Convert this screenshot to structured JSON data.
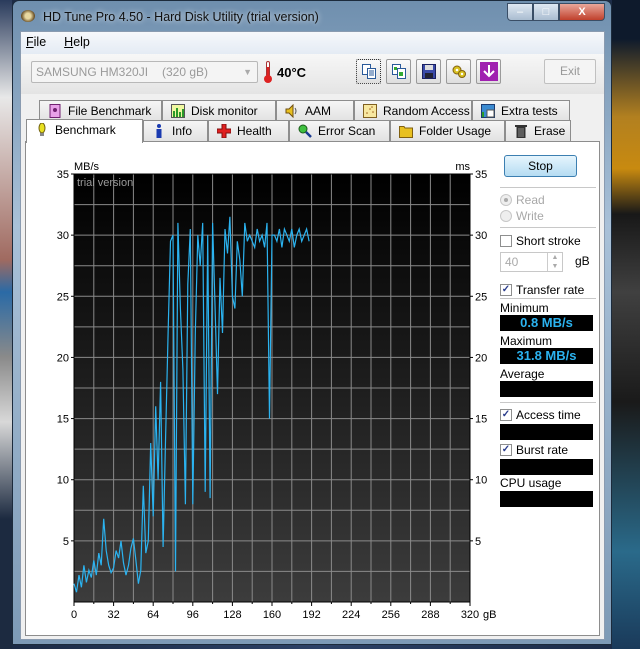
{
  "window": {
    "title": "HD Tune Pro 4.50 - Hard Disk Utility (trial version)",
    "controls": {
      "minimize": "–",
      "maximize": "□",
      "close": "X"
    }
  },
  "menu": {
    "items": [
      {
        "label": "File",
        "accel": "F"
      },
      {
        "label": "Help",
        "accel": "H"
      }
    ]
  },
  "toolbar": {
    "drive_name": "SAMSUNG HM320JI",
    "drive_size": "(320 gB)",
    "temperature": "40°C",
    "buttons": [
      {
        "name": "copy-text-icon"
      },
      {
        "name": "copy-screenshot-icon"
      },
      {
        "name": "save-icon"
      },
      {
        "name": "options-icon"
      },
      {
        "name": "download-icon"
      }
    ],
    "exit_label": "Exit"
  },
  "tabs": {
    "row1": [
      {
        "label": "File Benchmark",
        "icon": "file-benchmark-icon"
      },
      {
        "label": "Disk monitor",
        "icon": "disk-monitor-icon"
      },
      {
        "label": "AAM",
        "icon": "speaker-icon"
      },
      {
        "label": "Random Access",
        "icon": "random-access-icon"
      },
      {
        "label": "Extra tests",
        "icon": "extra-tests-icon"
      }
    ],
    "row2": [
      {
        "label": "Benchmark",
        "icon": "benchmark-icon",
        "active": true
      },
      {
        "label": "Info",
        "icon": "info-icon"
      },
      {
        "label": "Health",
        "icon": "health-icon"
      },
      {
        "label": "Error Scan",
        "icon": "error-scan-icon"
      },
      {
        "label": "Folder Usage",
        "icon": "folder-icon"
      },
      {
        "label": "Erase",
        "icon": "trash-icon"
      }
    ]
  },
  "side": {
    "stop_label": "Stop",
    "read_label": "Read",
    "write_label": "Write",
    "short_stroke_label": "Short stroke",
    "short_stroke_checked": false,
    "short_stroke_value": "40",
    "short_stroke_unit": "gB",
    "transfer_rate_label": "Transfer rate",
    "transfer_rate_checked": true,
    "minimum_label": "Minimum",
    "minimum_value": "0.8 MB/s",
    "maximum_label": "Maximum",
    "maximum_value": "31.8 MB/s",
    "average_label": "Average",
    "average_value": "",
    "access_time_label": "Access time",
    "access_time_checked": true,
    "access_time_value": "",
    "burst_rate_label": "Burst rate",
    "burst_rate_checked": true,
    "burst_rate_value": "",
    "cpu_usage_label": "CPU usage",
    "cpu_usage_value": ""
  },
  "chart_data": {
    "type": "line",
    "title": "",
    "watermark": "trial version",
    "ylabel": "MB/s",
    "ylabel_right": "ms",
    "xlabel": "gB",
    "ylim": [
      0,
      35
    ],
    "xlim": [
      0,
      320
    ],
    "yticks": [
      5,
      10,
      15,
      20,
      25,
      30,
      35
    ],
    "xticks": [
      0,
      32,
      64,
      96,
      128,
      160,
      192,
      224,
      256,
      288,
      320
    ],
    "grid": true,
    "line_color": "#2bb3f0",
    "series": [
      {
        "name": "Transfer rate",
        "x": [
          0,
          2,
          4,
          6,
          8,
          10,
          12,
          14,
          16,
          18,
          20,
          22,
          24,
          26,
          28,
          30,
          32,
          34,
          36,
          38,
          40,
          42,
          44,
          46,
          48,
          50,
          52,
          54,
          56,
          58,
          60,
          62,
          64,
          66,
          68,
          70,
          72,
          74,
          76,
          78,
          80,
          82,
          84,
          86,
          88,
          90,
          92,
          94,
          96,
          98,
          100,
          102,
          104,
          106,
          108,
          110,
          112,
          114,
          116,
          118,
          120,
          122,
          124,
          126,
          128,
          130,
          132,
          134,
          136,
          138,
          140,
          142,
          144,
          146,
          148,
          150,
          152,
          154,
          156,
          158,
          160,
          162,
          164,
          166,
          168,
          170,
          172,
          174,
          176,
          178,
          180,
          182,
          184,
          186,
          188,
          190
        ],
        "values": [
          1.5,
          0.8,
          2.2,
          1.2,
          3.0,
          1.6,
          2.6,
          2.0,
          3.4,
          2.2,
          4.0,
          3.0,
          6.8,
          4.2,
          3.0,
          2.4,
          2.8,
          4.2,
          3.6,
          5.0,
          3.2,
          2.2,
          3.0,
          4.4,
          5.2,
          3.4,
          1.5,
          2.6,
          9.5,
          4.0,
          5.0,
          13.0,
          7.0,
          16.0,
          10.0,
          18.0,
          4.5,
          13.5,
          22.0,
          29.5,
          30.0,
          2.5,
          31.0,
          24.0,
          19.0,
          8.0,
          26.0,
          30.5,
          8.0,
          22.0,
          30.0,
          27.5,
          31.0,
          9.0,
          30.0,
          8.5,
          31.0,
          24.0,
          17.0,
          26.5,
          22.0,
          30.5,
          28.5,
          31.5,
          25.0,
          24.0,
          29.5,
          28.0,
          25.0,
          31.0,
          29.5,
          30.0,
          29.5,
          29.0,
          30.5,
          29.5,
          30.0,
          29.0,
          31.0,
          15.0,
          30.0,
          30.0,
          29.5,
          30.5,
          29.0,
          30.5,
          30.0,
          29.5,
          30.5,
          29.0,
          30.0,
          30.5,
          29.5,
          30.0,
          30.5,
          29.5
        ]
      }
    ]
  }
}
